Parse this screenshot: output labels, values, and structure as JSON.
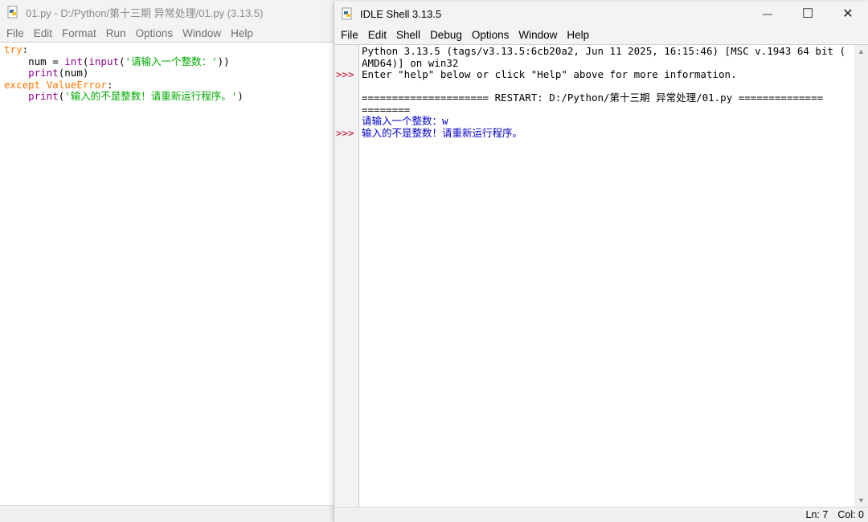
{
  "editor": {
    "title": "01.py - D:/Python/第十三期 异常处理/01.py (3.13.5)",
    "menu": [
      "File",
      "Edit",
      "Format",
      "Run",
      "Options",
      "Window",
      "Help"
    ],
    "code": [
      [
        {
          "t": "try",
          "c": "kw"
        },
        {
          "t": ":",
          "c": "plain"
        }
      ],
      [
        {
          "t": "    num = ",
          "c": "plain"
        },
        {
          "t": "int",
          "c": "bi"
        },
        {
          "t": "(",
          "c": "plain"
        },
        {
          "t": "input",
          "c": "bi"
        },
        {
          "t": "(",
          "c": "plain"
        },
        {
          "t": "'请输入一个整数：'",
          "c": "str"
        },
        {
          "t": "))",
          "c": "plain"
        }
      ],
      [
        {
          "t": "    ",
          "c": "plain"
        },
        {
          "t": "print",
          "c": "bi"
        },
        {
          "t": "(num)",
          "c": "plain"
        }
      ],
      [
        {
          "t": "except ",
          "c": "kw"
        },
        {
          "t": "ValueError",
          "c": "kw"
        },
        {
          "t": ":",
          "c": "plain"
        }
      ],
      [
        {
          "t": "    ",
          "c": "plain"
        },
        {
          "t": "print",
          "c": "bi"
        },
        {
          "t": "(",
          "c": "plain"
        },
        {
          "t": "'输入的不是整数！请重新运行程序。'",
          "c": "str"
        },
        {
          "t": ")",
          "c": "plain"
        }
      ]
    ]
  },
  "shell": {
    "title": "IDLE Shell 3.13.5",
    "menu": [
      "File",
      "Edit",
      "Shell",
      "Debug",
      "Options",
      "Window",
      "Help"
    ],
    "prompt_symbol": ">>>",
    "prompt_rows": [
      3,
      8
    ],
    "lines": [
      {
        "t": "Python 3.13.5 (tags/v3.13.5:6cb20a2, Jun 11 2025, 16:15:46) [MSC v.1943 64 bit (",
        "c": ""
      },
      {
        "t": "AMD64)] on win32",
        "c": ""
      },
      {
        "t": "Enter \"help\" below or click \"Help\" above for more information.",
        "c": ""
      },
      {
        "t": "",
        "c": ""
      },
      {
        "t": "===================== RESTART: D:/Python/第十三期 异常处理/01.py ==============",
        "c": ""
      },
      {
        "t": "========",
        "c": ""
      },
      {
        "t": "请输入一个整数：w",
        "c": "blue"
      },
      {
        "t": "输入的不是整数！请重新运行程序。",
        "c": "blue"
      }
    ],
    "status": {
      "line": "Ln: 7",
      "col": "Col: 0"
    },
    "window_buttons": {
      "minimize": "—",
      "maximize": "☐",
      "close": "✕"
    }
  }
}
